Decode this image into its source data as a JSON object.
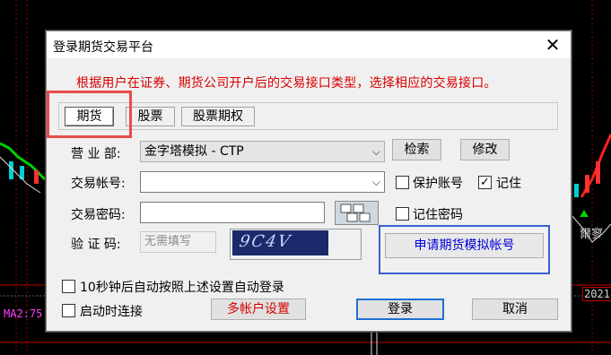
{
  "background": {
    "ma_label": "MA2:75",
    "year_label": "2021",
    "chart_text": "爾寥"
  },
  "dialog": {
    "title": "登录期货交易平台",
    "close_symbol": "✕",
    "hint": "根据用户在证券、期货公司开户后的交易接口类型，选择相应的交易接口。",
    "tabs": [
      {
        "label": "期货"
      },
      {
        "label": "股票"
      },
      {
        "label": "股票期权"
      }
    ],
    "branch": {
      "label": "营 业 部:",
      "value": "金字塔模拟 - CTP",
      "search_label": "检索",
      "edit_label": "修改"
    },
    "account": {
      "label": "交易帐号:",
      "value": "",
      "protect_label": "保护账号",
      "protect_checked": false,
      "remember_label": "记住",
      "remember_checked": true
    },
    "password": {
      "label": "交易密码:",
      "value": "",
      "remember_label": "记住密码",
      "remember_checked": false
    },
    "captcha": {
      "label": "验 证 码:",
      "placeholder": "无需填写",
      "image_text": "9C4V"
    },
    "apply_label": "申请期货模拟帐号",
    "auto_login": {
      "label": "10秒钟后自动按照上述设置自动登录",
      "checked": false
    },
    "connect_on_start": {
      "label": "启动时连接",
      "checked": false
    },
    "multi_account_label": "多帐户设置",
    "login_label": "登录",
    "cancel_label": "取消"
  },
  "colors": {
    "hint_red": "#d80000",
    "highlight_red": "#e84c4c",
    "apply_blue": "#0000d8",
    "focus_blue": "#1f6fd0"
  }
}
